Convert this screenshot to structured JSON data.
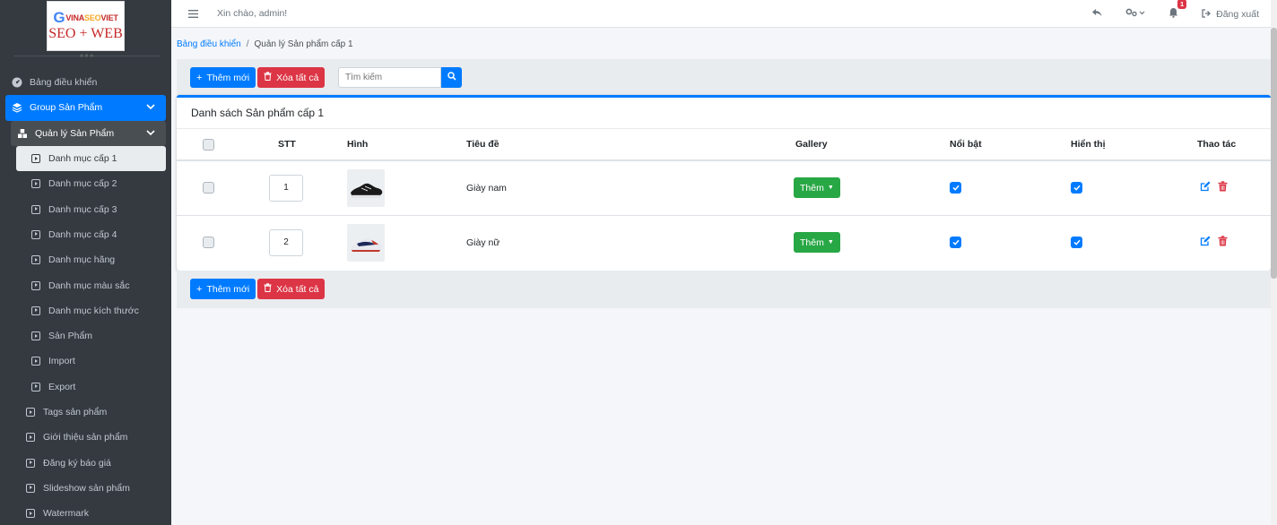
{
  "brand": {
    "logo_line1_g": "G",
    "logo_line1_vina": "VINA",
    "logo_line1_seo": "SEO",
    "logo_line1_viet": "VIET",
    "logo_line2": "SEO + WEB"
  },
  "topbar": {
    "greeting": "Xin chào, admin!",
    "notification_count": "1",
    "logout_label": "Đăng xuất"
  },
  "sidebar": {
    "items": [
      {
        "label": "Bảng điều khiển"
      },
      {
        "label": "Group Sản Phẩm"
      },
      {
        "label": "Quản lý Sản Phẩm"
      },
      {
        "label": "Danh mục cấp 1"
      },
      {
        "label": "Danh mục cấp 2"
      },
      {
        "label": "Danh mục cấp 3"
      },
      {
        "label": "Danh mục cấp 4"
      },
      {
        "label": "Danh mục hãng"
      },
      {
        "label": "Danh mục màu sắc"
      },
      {
        "label": "Danh mục kích thước"
      },
      {
        "label": "Sản Phẩm"
      },
      {
        "label": "Import"
      },
      {
        "label": "Export"
      },
      {
        "label": "Tags sản phẩm"
      },
      {
        "label": "Giới thiệu sản phẩm"
      },
      {
        "label": "Đăng ký báo giá"
      },
      {
        "label": "Slideshow sản phẩm"
      },
      {
        "label": "Watermark"
      }
    ]
  },
  "breadcrumb": {
    "home": "Bảng điều khiển",
    "separator": "/",
    "current": "Quản lý Sản phẩm cấp 1"
  },
  "toolbar": {
    "add_label": "Thêm mới",
    "delete_all_label": "Xóa tất cả",
    "search_placeholder": "Tìm kiếm"
  },
  "card": {
    "title": "Danh sách Sản phẩm cấp 1"
  },
  "table": {
    "headers": {
      "stt": "STT",
      "image": "Hình",
      "title": "Tiêu đề",
      "gallery": "Gallery",
      "featured": "Nổi bật",
      "visible": "Hiển thị",
      "actions": "Thao tác"
    },
    "rows": [
      {
        "stt": "1",
        "title": "Giày nam",
        "gallery_label": "Thêm",
        "featured": true,
        "visible": true
      },
      {
        "stt": "2",
        "title": "Giày nữ",
        "gallery_label": "Thêm",
        "featured": true,
        "visible": true
      }
    ]
  },
  "colors": {
    "primary": "#007bff",
    "danger": "#dc3545",
    "success": "#28a745",
    "sidebar_bg": "#343a40"
  }
}
